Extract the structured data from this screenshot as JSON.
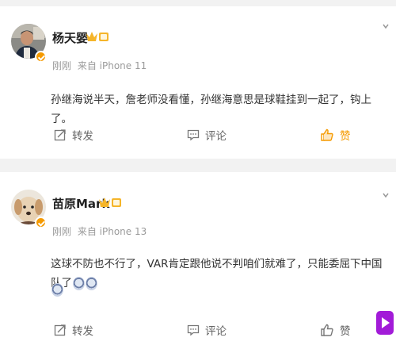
{
  "posts": [
    {
      "username": "杨天婴",
      "time": "刚刚",
      "source": "来自 iPhone 11",
      "content": "孙继海说半天，詹老师没看懂，孙继海意思是球鞋挂到一起了，钩上了。",
      "actions": {
        "repost": "转发",
        "comment": "评论",
        "like": "赞"
      },
      "like_color": "#f59a00",
      "badge_color": "#f5b52a"
    },
    {
      "username": "苗原Mark",
      "time": "刚刚",
      "source": "来自 iPhone 13",
      "content": "这球不防也不行了，VAR肯定跟他说不判咱们就难了，只能委屈下中国队了",
      "actions": {
        "repost": "转发",
        "comment": "评论",
        "like": "赞"
      },
      "like_color": "#666666",
      "badge_color": "#f5b52a"
    }
  ],
  "colors": {
    "accent": "#f59a00",
    "side_tab": "#a21bd8"
  },
  "icons": [
    "more-chevron-icon",
    "repost-icon",
    "comment-icon",
    "like-icon",
    "verified-icon",
    "vip-crown-icon",
    "sad-emoji-icon",
    "play-icon"
  ]
}
